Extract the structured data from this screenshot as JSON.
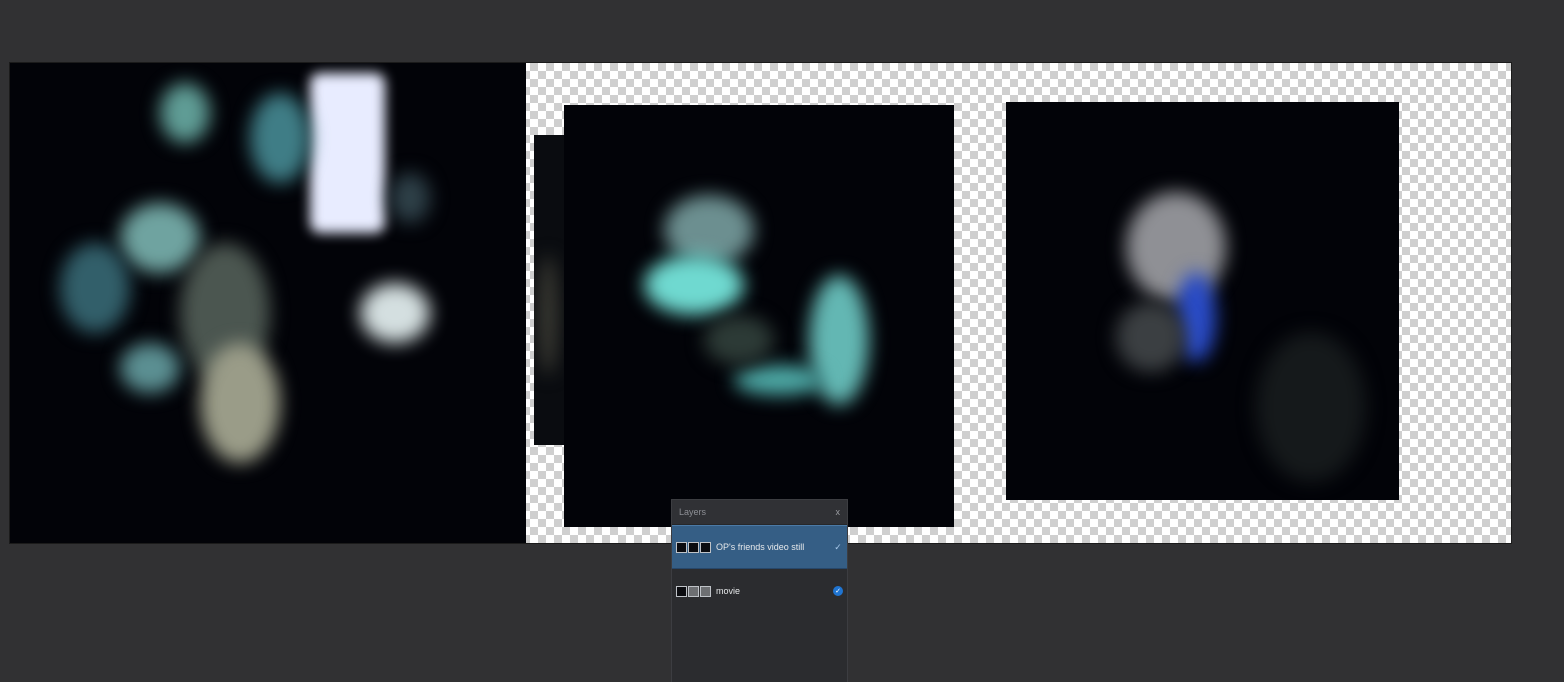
{
  "layers_panel": {
    "title": "Layers",
    "close_glyph": "x",
    "layers": [
      {
        "name": "OP's friends video still",
        "selected": true,
        "visible": true,
        "check_glyph": "✓"
      },
      {
        "name": "movie",
        "selected": false,
        "visible": true,
        "check_glyph": "✓"
      }
    ]
  },
  "icons": {
    "close": "close-icon",
    "visibility": "checkmark-icon",
    "thumbnail": "layer-thumbnail-icon"
  },
  "colors": {
    "workspace": "#313133",
    "panel": "#2b2c2f",
    "selected_row": "#355e85",
    "check_blue": "#1f74d1"
  }
}
